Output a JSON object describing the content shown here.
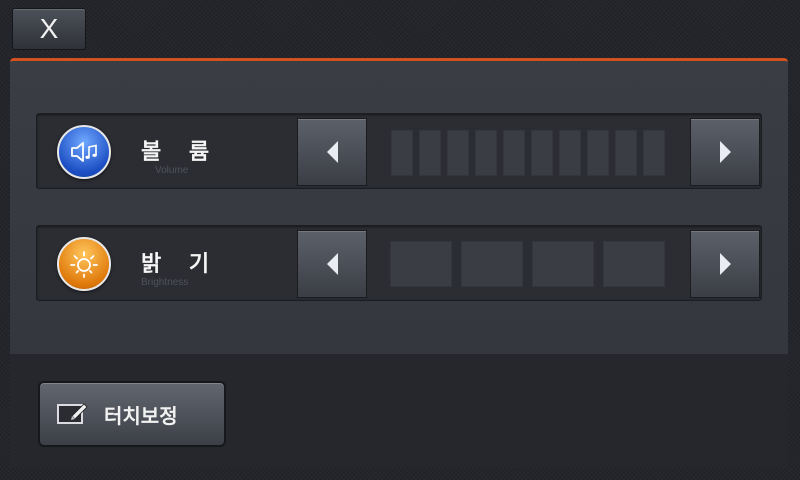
{
  "header": {
    "close_label": "X"
  },
  "settings": {
    "volume": {
      "label": "볼 륨",
      "sublabel": "Volume",
      "icon": "speaker-music-icon",
      "level_filled": 0,
      "level_total": 10
    },
    "brightness": {
      "label": "밝 기",
      "sublabel": "Brightness",
      "icon": "sun-icon",
      "level_filled": 0,
      "level_total": 4
    }
  },
  "footer": {
    "touch_calibration_label": "터치보정",
    "touch_calibration_icon": "pen-tablet-icon"
  },
  "colors": {
    "accent": "#d2511e",
    "volume_orb": "#2a5fd6",
    "brightness_orb": "#e8840f"
  }
}
